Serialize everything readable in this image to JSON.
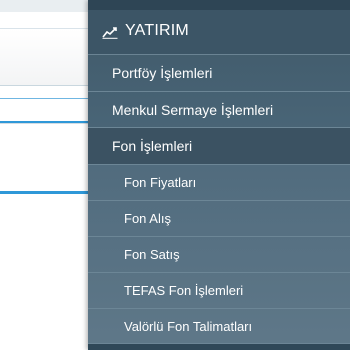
{
  "menu": {
    "section_title": "YATIRIM",
    "section_icon": "chart-line-icon",
    "items": [
      {
        "label": "Portföy İşlemleri",
        "level": 1
      },
      {
        "label": "Menkul Sermaye İşlemleri",
        "level": 1
      },
      {
        "label": "Fon İşlemleri",
        "level": 1,
        "selected": true
      },
      {
        "label": "Fon Fiyatları",
        "level": 2
      },
      {
        "label": "Fon Alış",
        "level": 2
      },
      {
        "label": "Fon Satış",
        "level": 2
      },
      {
        "label": "TEFAS Fon İşlemleri",
        "level": 2
      },
      {
        "label": "Valörlü Fon Talimatları",
        "level": 2
      }
    ]
  },
  "colors": {
    "menu_background": "#4a6678",
    "menu_header": "#3c5566",
    "accent_line": "#2f98d8",
    "text": "#ffffff"
  }
}
